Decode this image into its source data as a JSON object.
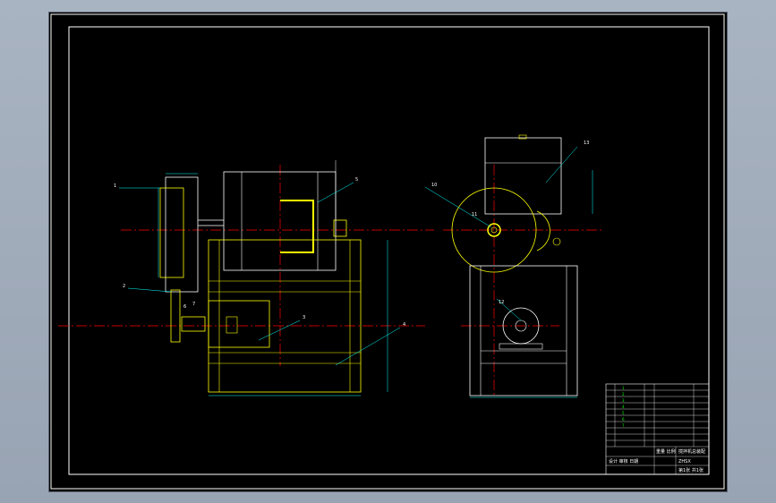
{
  "title_block": {
    "drawing_name": "搅拌机总装配",
    "drawing_no": "ZHSX",
    "sheet_info": "第1张 共1张",
    "weight_label": "重量 比例",
    "designer_row": "设计 审核 日期"
  },
  "colors": {
    "background": "#000000",
    "outline": "#ffffff",
    "part_yellow": "#ffff00",
    "dimension_cyan": "#00ffff",
    "centerline_red": "#ff0000",
    "text_green": "#00ff00"
  },
  "labels": {
    "front_view": [
      "1",
      "2",
      "3",
      "4",
      "5",
      "6",
      "7"
    ],
    "side_view": [
      "10",
      "11",
      "12",
      "13"
    ]
  }
}
